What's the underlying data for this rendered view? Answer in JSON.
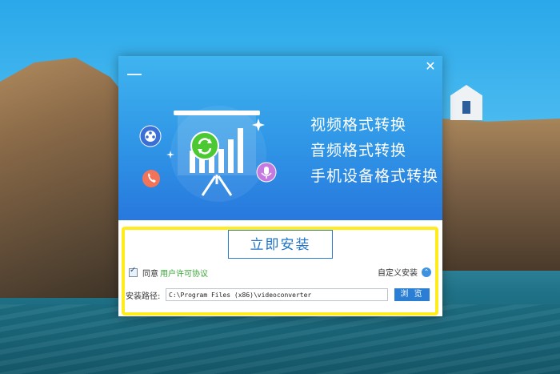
{
  "window": {
    "close_label": "✕"
  },
  "banner": {
    "features": [
      "视频格式转换",
      "音频格式转换",
      "手机设备格式转换"
    ]
  },
  "install": {
    "button_label": "立即安装",
    "agree_checked": true,
    "agree_text": "同意",
    "license_link": "用户许可协议",
    "custom_label": "自定义安装",
    "path_label": "安装路径:",
    "path_value": "C:\\Program Files (x86)\\videoconverter",
    "browse_label": "浏 览"
  },
  "icons": [
    "film-reel-icon",
    "refresh-icon",
    "phone-icon",
    "microphone-icon",
    "presentation-board-icon",
    "chevron-up-icon"
  ],
  "colors": {
    "banner_top": "#3fb4ef",
    "banner_bottom": "#2878dd",
    "accent": "#2a7fd5",
    "link_green": "#38a836",
    "highlight": "#ffec1f"
  }
}
